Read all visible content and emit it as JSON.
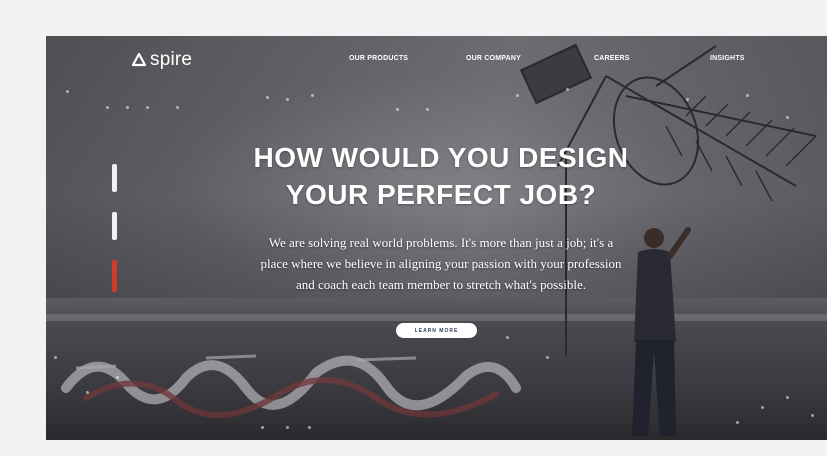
{
  "brand": {
    "name": "spire",
    "logo_icon": "triangle-logo-icon"
  },
  "nav": {
    "items": [
      {
        "label": "OUR PRODUCTS"
      },
      {
        "label": "OUR COMPANY"
      },
      {
        "label": "CAREERS"
      },
      {
        "label": "INSIGHTS"
      }
    ]
  },
  "hero": {
    "headline_line1": "HOW WOULD YOU DESIGN",
    "headline_line2": "YOUR PERFECT JOB?",
    "subtext_line1": "We are solving real world problems. It's more than just a job; it's a",
    "subtext_line2": "place where we believe in aligning your passion with your profession",
    "subtext_line3": "and coach each team member to stretch what's possible.",
    "cta_label": "LEARN MORE",
    "slide_indicator": {
      "active_index": 2,
      "count": 3
    }
  },
  "colors": {
    "page_background": "#f2f2f2",
    "accent_red": "#d33a2a",
    "text_white": "#ffffff",
    "button_text": "#2c3d55"
  }
}
